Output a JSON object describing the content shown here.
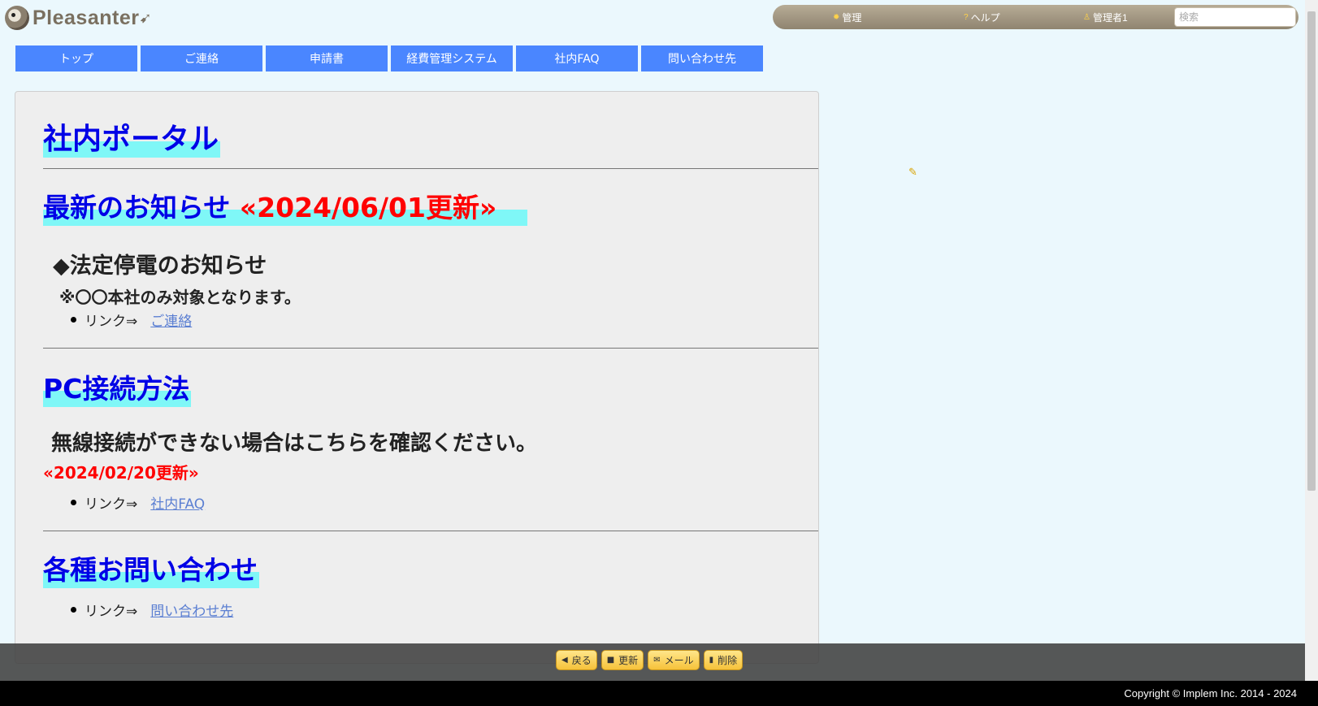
{
  "logo": {
    "text": "Pleasanter"
  },
  "topnav": {
    "admin_label": "管理",
    "help_label": "ヘルプ",
    "user_label": "管理者1",
    "search_placeholder": "検索"
  },
  "menu": {
    "items": [
      {
        "label": "トップ"
      },
      {
        "label": "ご連絡"
      },
      {
        "label": "申請書"
      },
      {
        "label": "経費管理システム"
      },
      {
        "label": "社内FAQ"
      },
      {
        "label": "問い合わせ先"
      }
    ]
  },
  "content": {
    "title": "社内ポータル",
    "news": {
      "heading": "最新のお知らせ",
      "date": "«2024/06/01更新»",
      "item_title": "◆法定停電のお知らせ",
      "note": "※〇〇本社のみ対象となります。",
      "link_prefix": "リンク⇒",
      "link_text": "ご連絡"
    },
    "pc": {
      "heading": "PC接続方法",
      "text": "無線接続ができない場合はこちらを確認ください。",
      "date": "«2024/02/20更新»",
      "link_prefix": "リンク⇒",
      "link_text": "社内FAQ"
    },
    "contact": {
      "heading": "各種お問い合わせ",
      "link_prefix": "リンク⇒",
      "link_text": "問い合わせ先"
    }
  },
  "actions": {
    "back": "戻る",
    "update": "更新",
    "mail": "メール",
    "delete": "削除"
  },
  "footer": {
    "copyright": "Copyright © Implem Inc. 2014 - 2024"
  },
  "colors": {
    "background": "#ebf8fd",
    "menu": "#4a86ff",
    "heading": "#0000e6",
    "heading_highlight": "#7ff7f7",
    "date_red": "#ff0000",
    "link": "#5b7fd2",
    "button": "#f6c23a"
  }
}
